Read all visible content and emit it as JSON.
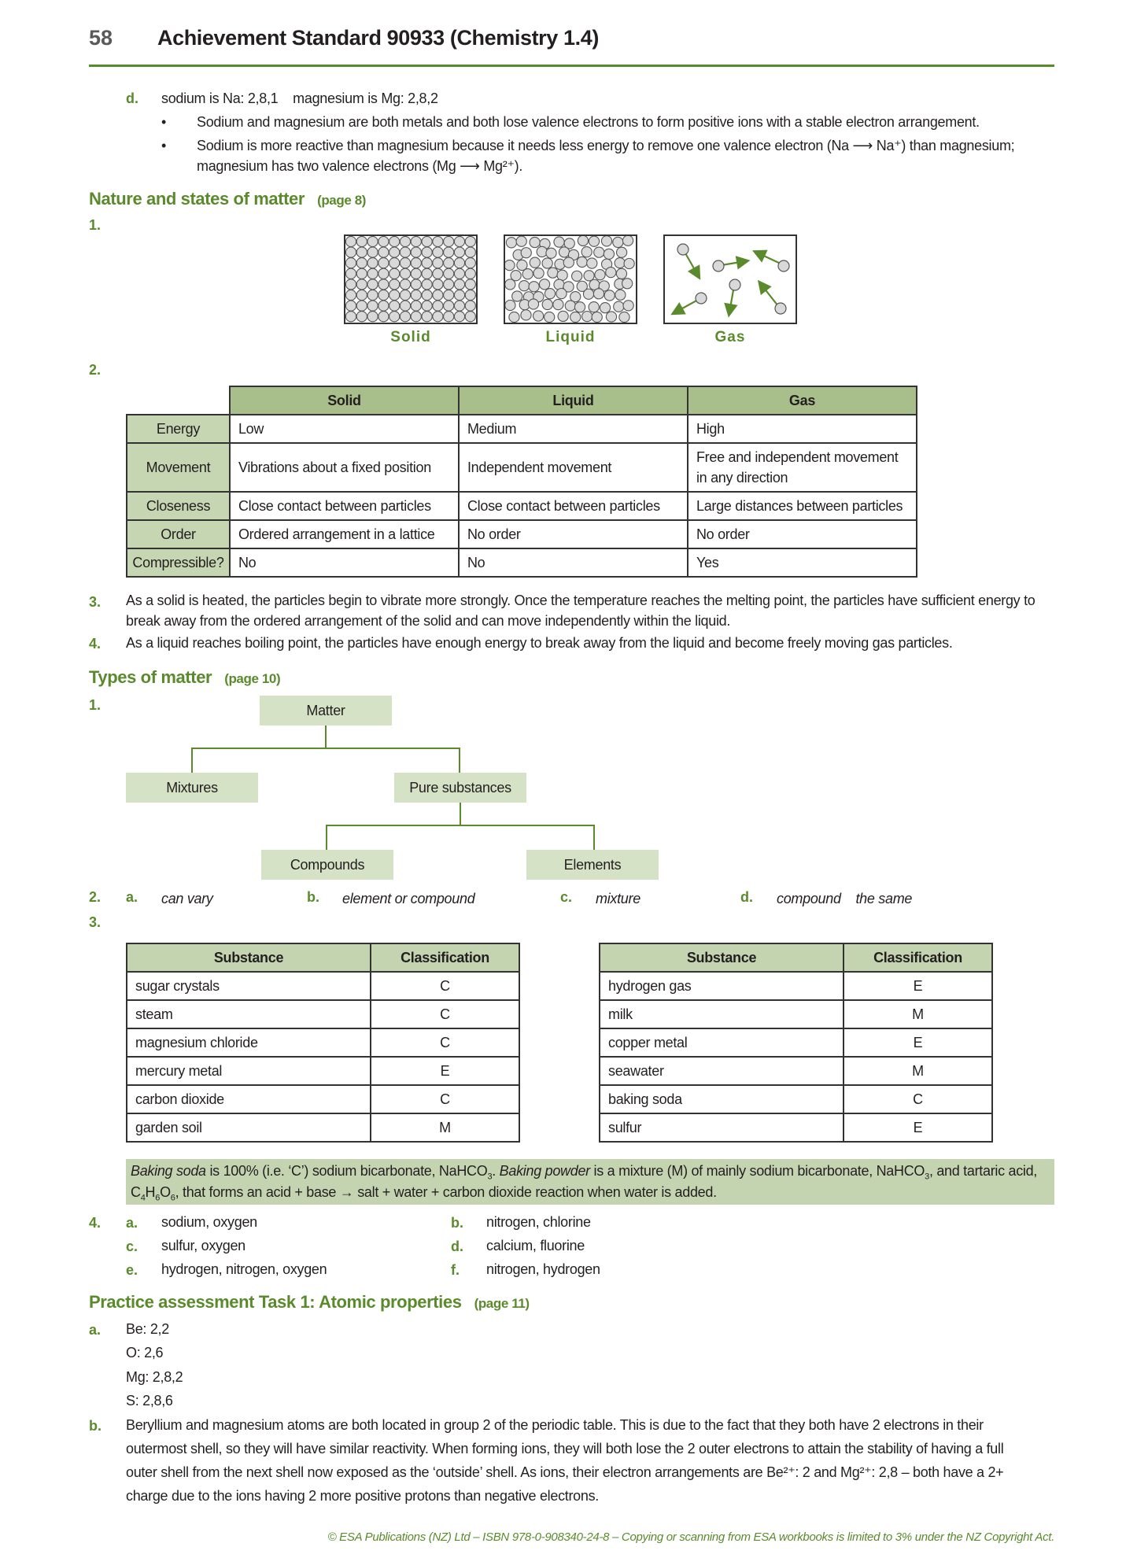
{
  "header": {
    "page_number": "58",
    "title": "Achievement Standard 90933 (Chemistry 1.4)"
  },
  "intro": {
    "label": "d.",
    "line": "sodium is Na: 2,8,1    magnesium is Mg: 2,8,2",
    "bullets": [
      "Sodium and magnesium are both metals and both lose valence electrons to form positive ions with a stable electron arrangement.",
      "Sodium is more reactive than magnesium because it needs less energy to remove one valence electron (Na ⟶ Na⁺) than magnesium;",
      "magnesium has two valence electrons (Mg ⟶ Mg²⁺)."
    ]
  },
  "states": {
    "heading": "Nature and states of matter",
    "page_ref": "(page 8)",
    "q1_label": "1.",
    "diagrams": [
      {
        "label": "Solid",
        "icon": "solid-particles-icon"
      },
      {
        "label": "Liquid",
        "icon": "liquid-particles-icon"
      },
      {
        "label": "Gas",
        "icon": "gas-particles-icon"
      }
    ],
    "q2_label": "2.",
    "table": {
      "columns": [
        "Solid",
        "Liquid",
        "Gas"
      ],
      "rows": [
        {
          "head": "Energy",
          "cells": [
            "Low",
            "Medium",
            "High"
          ]
        },
        {
          "head": "Movement",
          "cells": [
            "Vibrations about a fixed position",
            "Independent movement",
            "Free and independent movement in any direction"
          ]
        },
        {
          "head": "Closeness",
          "cells": [
            "Close contact between particles",
            "Close contact between particles",
            "Large distances between particles"
          ]
        },
        {
          "head": "Order",
          "cells": [
            "Ordered arrangement in a lattice",
            "No order",
            "No order"
          ]
        },
        {
          "head": "Compressible?",
          "cells": [
            "No",
            "No",
            "Yes"
          ]
        }
      ]
    },
    "q3_label": "3.",
    "q3_text": "As a solid is heated, the particles begin to vibrate more strongly. Once the temperature reaches the melting point, the particles have sufficient energy to break away from the ordered arrangement of the solid and can move independently within the liquid.",
    "q4_label": "4.",
    "q4_text": "As a liquid reaches boiling point, the particles have enough energy to break away from the liquid and become freely moving gas particles."
  },
  "types": {
    "heading": "Types of matter",
    "page_ref": "(page 10)",
    "q1_label": "1.",
    "tree": {
      "root": "Matter",
      "mixtures": "Mixtures",
      "pure": "Pure substances",
      "compounds": "Compounds",
      "elements": "Elements"
    },
    "q2_label": "2.",
    "q2": [
      {
        "label": "a.",
        "answer": "can vary"
      },
      {
        "label": "b.",
        "answer": "element or compound"
      },
      {
        "label": "c.",
        "answer": "mixture"
      },
      {
        "label": "d.",
        "answer": "compound    the same"
      }
    ],
    "q3_label": "3.",
    "table_headers": [
      "Substance",
      "Classification"
    ],
    "table_left": [
      [
        "sugar crystals",
        "C"
      ],
      [
        "steam",
        "C"
      ],
      [
        "magnesium chloride",
        "C"
      ],
      [
        "mercury metal",
        "E"
      ],
      [
        "carbon dioxide",
        "C"
      ],
      [
        "garden soil",
        "M"
      ]
    ],
    "table_right": [
      [
        "hydrogen gas",
        "E"
      ],
      [
        "milk",
        "M"
      ],
      [
        "copper metal",
        "E"
      ],
      [
        "seawater",
        "M"
      ],
      [
        "baking soda",
        "C"
      ],
      [
        "sulfur",
        "E"
      ]
    ],
    "note": {
      "baking_soda": "Baking soda",
      "part1": " is 100% (i.e. ‘C’) sodium bicarbonate, NaHCO",
      "sub3": "3",
      "part2": ". ",
      "baking_powder": "Baking powder",
      "part3": " is a mixture (M) of mainly sodium bicarbonate, NaHCO",
      "part4": ", and tartaric acid,",
      "formula_c": "C",
      "sub4": "4",
      "formula_h": "H",
      "sub6a": "6",
      "formula_o": "O",
      "sub6b": "6",
      "part5": ", that forms an acid + base → salt + water + carbon dioxide reaction when water is added."
    },
    "q4_label": "4.",
    "q4": [
      {
        "label": "a.",
        "answer": "sodium, oxygen"
      },
      {
        "label": "b.",
        "answer": "nitrogen, chlorine"
      },
      {
        "label": "c.",
        "answer": "sulfur, oxygen"
      },
      {
        "label": "d.",
        "answer": "calcium, fluorine"
      },
      {
        "label": "e.",
        "answer": "hydrogen, nitrogen, oxygen"
      },
      {
        "label": "f.",
        "answer": "nitrogen, hydrogen"
      }
    ]
  },
  "practice": {
    "heading": "Practice assessment Task 1: Atomic properties",
    "page_ref": "(page 11)",
    "a_label": "a.",
    "a_lines": [
      "Be: 2,2",
      "O: 2,6",
      "Mg: 2,8,2",
      "S: 2,8,6"
    ],
    "b_label": "b.",
    "b_lines": [
      "Beryllium and magnesium atoms are both located in group 2 of the periodic table. This is due to the fact that they both have 2 electrons in their",
      "outermost shell, so they will have similar reactivity. When forming ions, they will both lose the 2 outer electrons to attain the stability of having a full",
      "outer shell from the next shell now exposed as the ‘outside’ shell. As ions, their electron arrangements are Be²⁺: 2 and Mg²⁺: 2,8 – both have a 2+",
      "charge due to the ions having 2 more positive protons than negative electrons."
    ]
  },
  "footer": {
    "text": "© ESA Publications (NZ) Ltd  –  ISBN 978-0-908340-24-8 –  Copying or scanning from ESA workbooks is limited to 3% under the NZ Copyright Act."
  },
  "colors": {
    "accent_green": "#5a8a2c",
    "table_header_green": "#a8bf8b",
    "row_header_green": "#c7d6b2",
    "tree_node_green": "#d6e2c6"
  }
}
